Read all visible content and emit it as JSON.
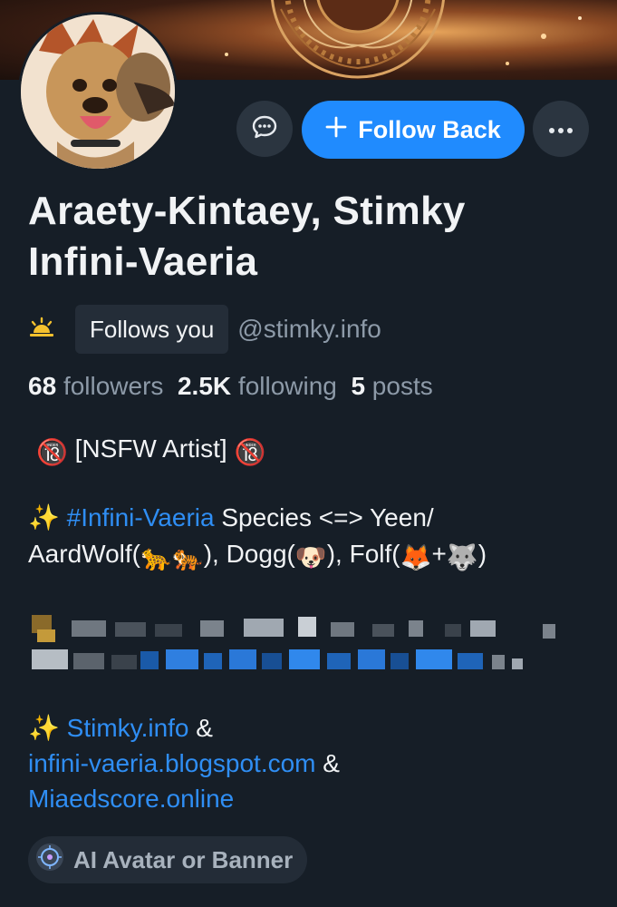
{
  "profile": {
    "display_name_line1": "Araety-Kintaey, Stimky",
    "display_name_line2": "Infini-Vaeria",
    "follows_you_label": "Follows you",
    "handle": "@stimky.info"
  },
  "actions": {
    "follow_back_label": "Follow Back",
    "follow_back_icon": "plus-icon",
    "message_icon": "chat-bubble-icon",
    "more_icon": "ellipsis-icon"
  },
  "stats": {
    "followers_count": "68",
    "followers_label": "followers",
    "following_count": "2.5K",
    "following_label": "following",
    "posts_count": "5",
    "posts_label": "posts"
  },
  "bio": {
    "line1_text": "[NSFW Artist]",
    "line1_emoji": "🔞",
    "line2_prefix": "✨",
    "line2_hashtag": "#Infini-Vaeria",
    "line2_rest": "Species <=> Yeen/",
    "line3_text_a": "AardWolf(",
    "line3_emoji_a": "🐆🐅",
    "line3_text_b": "), Dogg(",
    "line3_emoji_b": "🐶",
    "line3_text_c": "), Folf(",
    "line3_emoji_c": "🦊",
    "line3_plus": "+",
    "line3_emoji_d": "🐺",
    "line3_text_d": ")",
    "links_prefix": "✨",
    "link1": "Stimky.info",
    "amp": "&",
    "link2": "infini-vaeria.blogspot.com",
    "link3": "Miaedscore.online"
  },
  "labels": {
    "ai_label": "AI Avatar or Banner"
  },
  "colors": {
    "background": "#161e27",
    "accent": "#208bfe",
    "link": "#2f8ef4",
    "muted": "#8d9aa8"
  }
}
